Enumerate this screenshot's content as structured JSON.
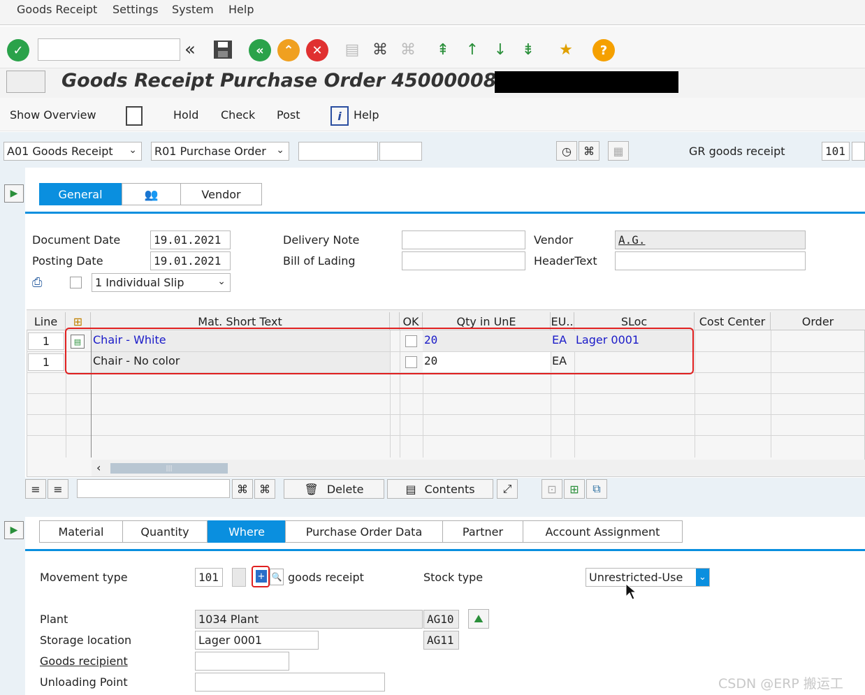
{
  "menu": [
    "Goods Receipt",
    "Settings",
    "System",
    "Help"
  ],
  "toolbar": {
    "back_label": "«"
  },
  "title": "Goods Receipt Purchase Order 4500000806",
  "app_toolbar": {
    "overview": "Show Overview",
    "hold": "Hold",
    "check": "Check",
    "post": "Post",
    "help": "Help"
  },
  "header_row": {
    "action": "A01  Goods Receipt",
    "ref": "R01  Purchase Order",
    "mvt_label": "GR goods receipt",
    "mvt_value": "101"
  },
  "tabs_top": [
    "General",
    "",
    "Vendor"
  ],
  "general": {
    "document_date_label": "Document Date",
    "document_date": "19.01.2021",
    "posting_date_label": "Posting Date",
    "posting_date": "19.01.2021",
    "slip": "1 Individual Slip",
    "delivery_note_label": "Delivery Note",
    "delivery_note": "",
    "bill_label": "Bill of Lading",
    "bill": "",
    "vendor_label": "Vendor",
    "vendor": "A.G.",
    "headertext_label": "HeaderText",
    "headertext": ""
  },
  "table": {
    "columns": [
      "Line",
      "",
      "Mat. Short Text",
      "",
      "OK",
      "Qty in UnE",
      "EU..",
      "SLoc",
      "Cost Center",
      "Order"
    ],
    "rows": [
      {
        "line": "1",
        "text": "Chair - White",
        "qty": "20",
        "eu": "EA",
        "sloc": "Lager 0001"
      },
      {
        "line": "1",
        "text": "Chair - No color",
        "qty": "20",
        "eu": "EA",
        "sloc": ""
      }
    ]
  },
  "grid_toolbar": {
    "delete": "Delete",
    "contents": "Contents"
  },
  "tabs_bottom": [
    "Material",
    "Quantity",
    "Where",
    "Purchase Order Data",
    "Partner",
    "Account Assignment"
  ],
  "where": {
    "movement_type_label": "Movement type",
    "movement_type": "101",
    "movement_text": "goods receipt",
    "stock_type_label": "Stock type",
    "stock_type": "Unrestricted-Use",
    "plant_label": "Plant",
    "plant": "1034 Plant",
    "plant_code": "AG10",
    "storage_label": "Storage location",
    "storage": "Lager 0001",
    "storage_code": "AG11",
    "recipient_label": "Goods recipient",
    "recipient": "",
    "unloading_label": "Unloading Point",
    "unloading": ""
  },
  "watermark": "CSDN @ERP 搬运工",
  "colors": {
    "accent": "#0a8fdf",
    "highlight": "#e02020",
    "link": "#1a1ac8"
  }
}
